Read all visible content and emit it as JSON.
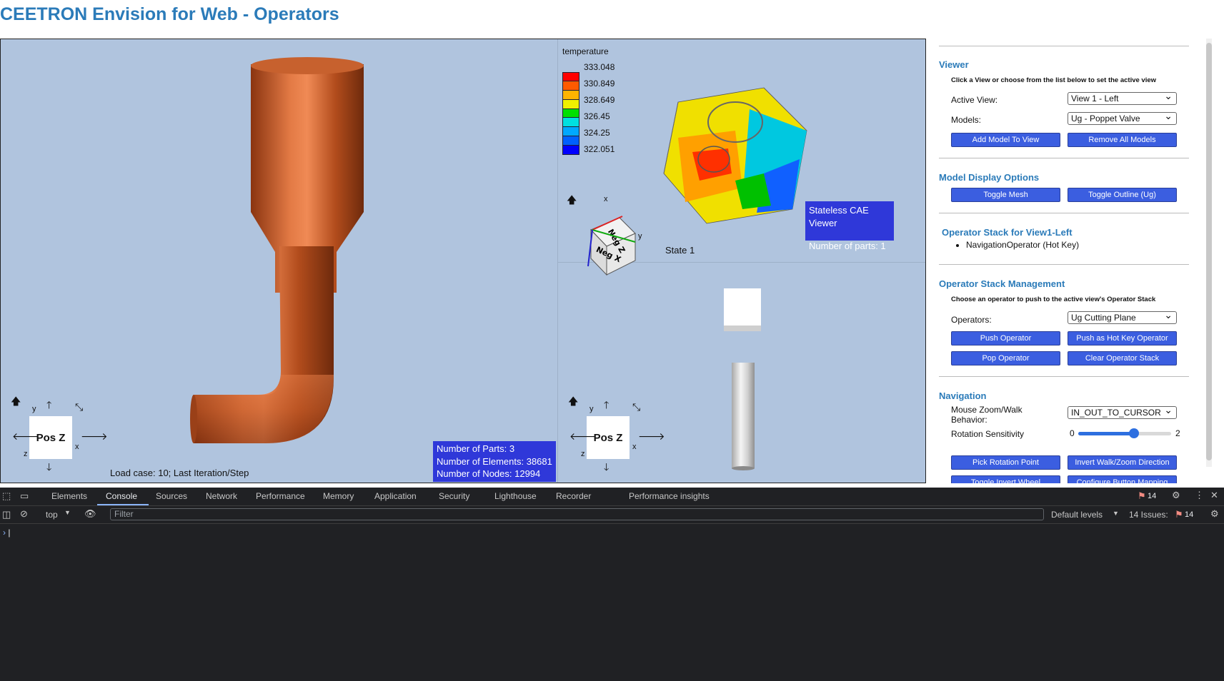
{
  "page": {
    "title": "CEETRON Envision for Web - Operators"
  },
  "view_left": {
    "cube_label": "Pos Z",
    "axis_y": "y",
    "axis_x": "x",
    "axis_z": "z",
    "load_case": "Load case: 10; Last Iteration/Step",
    "info": [
      "Number of Parts: 3",
      "Number of Elements: 38681",
      "Number of Nodes: 12994"
    ]
  },
  "view_top_right": {
    "legend_title": "temperature",
    "legend_values": [
      "333.048",
      "330.849",
      "328.649",
      "326.45",
      "324.25",
      "322.051"
    ],
    "legend_colors": [
      "#ff0000",
      "#ff5a00",
      "#ffb400",
      "#f0f000",
      "#00e000",
      "#00e0e0",
      "#00a8ff",
      "#0060ff",
      "#0000ff"
    ],
    "cube_face_top": "Neg Z",
    "cube_face_front": "Neg X",
    "axis_x": "x",
    "axis_y": "y",
    "state_label": "State 1",
    "info_title": "Stateless CAE Viewer",
    "info_parts": "Number of parts: 1"
  },
  "view_bottom_right": {
    "cube_label": "Pos Z",
    "axis_y": "y",
    "axis_x": "x",
    "axis_z": "z"
  },
  "panel": {
    "viewer": {
      "heading": "Viewer",
      "note": "Click a View or choose from the list below to set the active view",
      "active_view_label": "Active View:",
      "active_view_value": "View 1 - Left",
      "models_label": "Models:",
      "models_value": "Ug - Poppet Valve",
      "add_model": "Add Model To View",
      "remove_models": "Remove All Models"
    },
    "display": {
      "heading": "Model Display Options",
      "toggle_mesh": "Toggle Mesh",
      "toggle_outline": "Toggle Outline (Ug)"
    },
    "stack": {
      "heading": "Operator Stack for View1-Left",
      "items": [
        "NavigationOperator (Hot Key)"
      ]
    },
    "management": {
      "heading": "Operator Stack Management",
      "note": "Choose an operator to push to the active view's Operator Stack",
      "operators_label": "Operators:",
      "operators_value": "Ug Cutting Plane",
      "push": "Push Operator",
      "push_hot": "Push as Hot Key Operator",
      "pop": "Pop Operator",
      "clear": "Clear Operator Stack"
    },
    "navigation": {
      "heading": "Navigation",
      "zoom_label": "Mouse Zoom/Walk Behavior:",
      "zoom_value": "IN_OUT_TO_CURSOR",
      "rotation_label": "Rotation Sensitivity",
      "slider_min": "0",
      "slider_max": "2",
      "slider_value": 1.2,
      "pick_rotation": "Pick Rotation Point",
      "invert_walk": "Invert Walk/Zoom Direction",
      "toggle_wheel": "Toggle Invert Wheel",
      "configure_mapping": "Configure Button Mapping"
    }
  },
  "devtools": {
    "tabs": [
      "Elements",
      "Console",
      "Sources",
      "Network",
      "Performance",
      "Memory",
      "Application",
      "Security",
      "Lighthouse",
      "Recorder",
      "Performance insights"
    ],
    "active_tab": "Console",
    "issues_count": "14",
    "context": "top",
    "filter_placeholder": "Filter",
    "levels": "Default levels",
    "issues_label": "14 Issues:",
    "issues_badge": "14"
  }
}
